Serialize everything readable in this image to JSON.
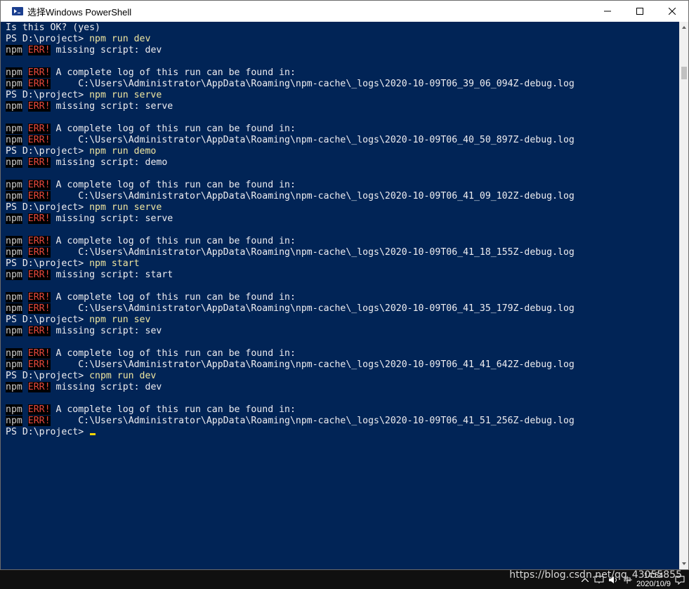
{
  "window": {
    "title": "选择Windows PowerShell",
    "minimize": "—",
    "maximize": "☐",
    "close": "✕"
  },
  "colors": {
    "console_bg": "#012456",
    "text": "#eeedf0",
    "command": "#f0e6a0",
    "err": "#e5483c",
    "cursor": "#ffd700"
  },
  "console_lines": [
    {
      "type": "plain",
      "text": "Is this OK? (yes)"
    },
    {
      "type": "prompt",
      "prompt": "PS D:\\project> ",
      "command": "npm run dev"
    },
    {
      "type": "err",
      "npm": "npm",
      "err": "ERR!",
      "text": " missing script: dev"
    },
    {
      "type": "blank",
      "text": ""
    },
    {
      "type": "err",
      "npm": "npm",
      "err": "ERR!",
      "text": " A complete log of this run can be found in:"
    },
    {
      "type": "err",
      "npm": "npm",
      "err": "ERR!",
      "text": "     C:\\Users\\Administrator\\AppData\\Roaming\\npm-cache\\_logs\\2020-10-09T06_39_06_094Z-debug.log"
    },
    {
      "type": "prompt",
      "prompt": "PS D:\\project> ",
      "command": "npm run serve"
    },
    {
      "type": "err",
      "npm": "npm",
      "err": "ERR!",
      "text": " missing script: serve"
    },
    {
      "type": "blank",
      "text": ""
    },
    {
      "type": "err",
      "npm": "npm",
      "err": "ERR!",
      "text": " A complete log of this run can be found in:"
    },
    {
      "type": "err",
      "npm": "npm",
      "err": "ERR!",
      "text": "     C:\\Users\\Administrator\\AppData\\Roaming\\npm-cache\\_logs\\2020-10-09T06_40_50_897Z-debug.log"
    },
    {
      "type": "prompt",
      "prompt": "PS D:\\project> ",
      "command": "npm run demo"
    },
    {
      "type": "err",
      "npm": "npm",
      "err": "ERR!",
      "text": " missing script: demo"
    },
    {
      "type": "blank",
      "text": ""
    },
    {
      "type": "err",
      "npm": "npm",
      "err": "ERR!",
      "text": " A complete log of this run can be found in:"
    },
    {
      "type": "err",
      "npm": "npm",
      "err": "ERR!",
      "text": "     C:\\Users\\Administrator\\AppData\\Roaming\\npm-cache\\_logs\\2020-10-09T06_41_09_102Z-debug.log"
    },
    {
      "type": "prompt",
      "prompt": "PS D:\\project> ",
      "command": "npm run serve"
    },
    {
      "type": "err",
      "npm": "npm",
      "err": "ERR!",
      "text": " missing script: serve"
    },
    {
      "type": "blank",
      "text": ""
    },
    {
      "type": "err",
      "npm": "npm",
      "err": "ERR!",
      "text": " A complete log of this run can be found in:"
    },
    {
      "type": "err",
      "npm": "npm",
      "err": "ERR!",
      "text": "     C:\\Users\\Administrator\\AppData\\Roaming\\npm-cache\\_logs\\2020-10-09T06_41_18_155Z-debug.log"
    },
    {
      "type": "prompt",
      "prompt": "PS D:\\project> ",
      "command": "npm start"
    },
    {
      "type": "err",
      "npm": "npm",
      "err": "ERR!",
      "text": " missing script: start"
    },
    {
      "type": "blank",
      "text": ""
    },
    {
      "type": "err",
      "npm": "npm",
      "err": "ERR!",
      "text": " A complete log of this run can be found in:"
    },
    {
      "type": "err",
      "npm": "npm",
      "err": "ERR!",
      "text": "     C:\\Users\\Administrator\\AppData\\Roaming\\npm-cache\\_logs\\2020-10-09T06_41_35_179Z-debug.log"
    },
    {
      "type": "prompt",
      "prompt": "PS D:\\project> ",
      "command": "npm run sev"
    },
    {
      "type": "err",
      "npm": "npm",
      "err": "ERR!",
      "text": " missing script: sev"
    },
    {
      "type": "blank",
      "text": ""
    },
    {
      "type": "err",
      "npm": "npm",
      "err": "ERR!",
      "text": " A complete log of this run can be found in:"
    },
    {
      "type": "err",
      "npm": "npm",
      "err": "ERR!",
      "text": "     C:\\Users\\Administrator\\AppData\\Roaming\\npm-cache\\_logs\\2020-10-09T06_41_41_642Z-debug.log"
    },
    {
      "type": "prompt",
      "prompt": "PS D:\\project> ",
      "command": "cnpm run dev"
    },
    {
      "type": "err",
      "npm": "npm",
      "err": "ERR!",
      "text": " missing script: dev"
    },
    {
      "type": "blank",
      "text": ""
    },
    {
      "type": "err",
      "npm": "npm",
      "err": "ERR!",
      "text": " A complete log of this run can be found in:"
    },
    {
      "type": "err",
      "npm": "npm",
      "err": "ERR!",
      "text": "     C:\\Users\\Administrator\\AppData\\Roaming\\npm-cache\\_logs\\2020-10-09T06_41_51_256Z-debug.log"
    },
    {
      "type": "current",
      "prompt": "PS D:\\project> ",
      "command": ""
    }
  ],
  "taskbar": {
    "tray_icons": [
      "chevron-up-icon",
      "network-icon",
      "volume-icon"
    ],
    "ime": "中",
    "time": "14:54",
    "date": "2020/10/9",
    "notifications_icon": "notifications-icon"
  },
  "watermark": "https://blog.csdn.net/qq_43055855"
}
